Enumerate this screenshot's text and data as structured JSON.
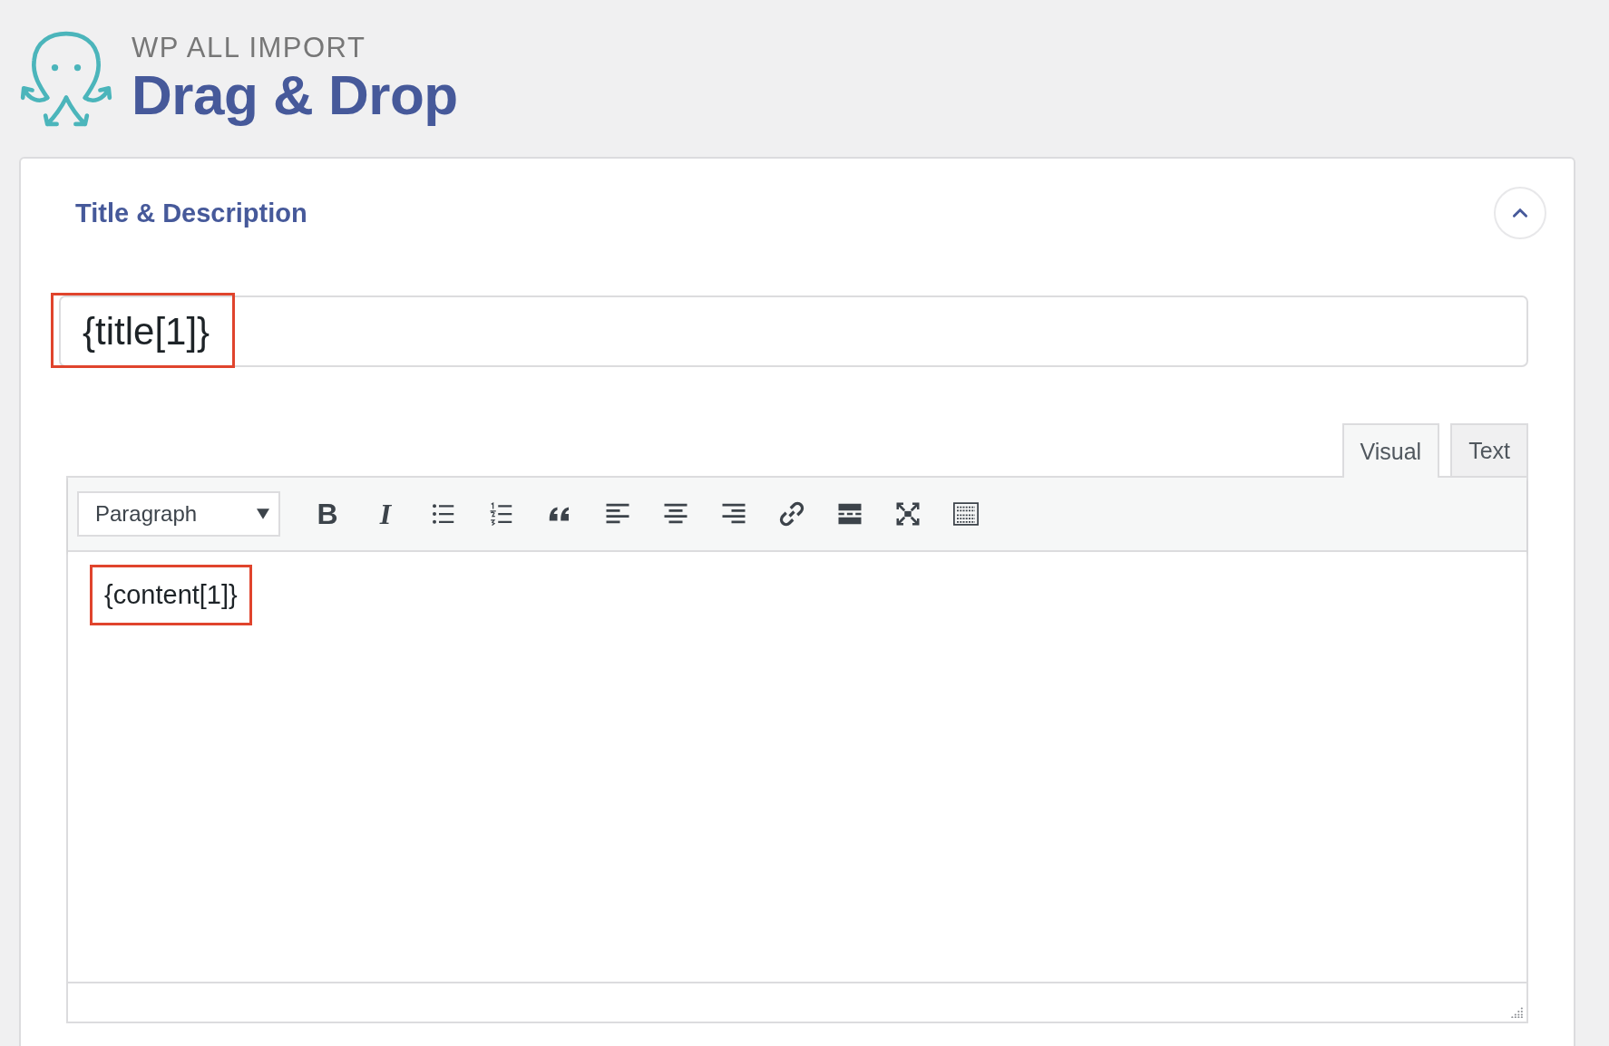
{
  "header": {
    "brand": "WP ALL IMPORT",
    "title": "Drag & Drop"
  },
  "section": {
    "title": "Title & Description",
    "expanded": true
  },
  "title_field": {
    "value": "{title[1]}",
    "highlighted": true
  },
  "editor_tabs": [
    {
      "label": "Visual",
      "selected": true
    },
    {
      "label": "Text",
      "selected": false
    }
  ],
  "format_select": {
    "value": "Paragraph"
  },
  "toolbar": [
    {
      "kind": "bold",
      "glyph": "B"
    },
    {
      "kind": "italic",
      "glyph": "I"
    },
    {
      "kind": "bullet-list"
    },
    {
      "kind": "numbered-list"
    },
    {
      "kind": "quote"
    },
    {
      "kind": "align-left"
    },
    {
      "kind": "align-center"
    },
    {
      "kind": "align-right"
    },
    {
      "kind": "link"
    },
    {
      "kind": "read-more"
    },
    {
      "kind": "fullscreen"
    },
    {
      "kind": "keyboard"
    }
  ],
  "editor_content": {
    "text": "{content[1]}",
    "highlighted": true
  }
}
